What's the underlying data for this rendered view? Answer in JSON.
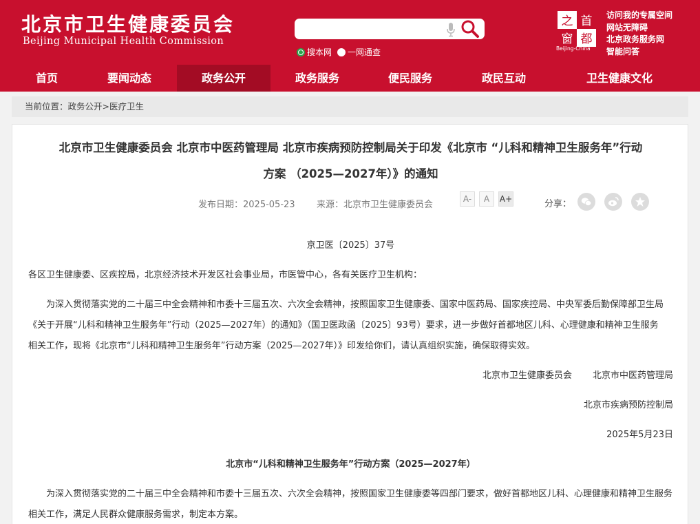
{
  "header": {
    "title": "北京市卫生健康委员会",
    "subtitle": "Beijing Municipal Health Commission",
    "search": {
      "placeholder": ""
    },
    "search_scopes": [
      {
        "label": "搜本网",
        "checked": true
      },
      {
        "label": "一网通查",
        "checked": false
      }
    ],
    "logo": {
      "chars": [
        "首",
        "都",
        "之",
        "窗"
      ],
      "caption": "Beijing-China"
    },
    "quick_links": [
      "访问我的专属空间",
      "网站无障碍",
      "北京政务服务网",
      "智能问答"
    ]
  },
  "nav": {
    "items": [
      {
        "label": "首页",
        "active": false
      },
      {
        "label": "要闻动态",
        "active": false
      },
      {
        "label": "政务公开",
        "active": true
      },
      {
        "label": "政务服务",
        "active": false
      },
      {
        "label": "便民服务",
        "active": false
      },
      {
        "label": "政民互动",
        "active": false
      },
      {
        "label": "卫生健康文化",
        "active": false
      }
    ]
  },
  "breadcrumb": {
    "prefix": "当前位置：",
    "items": [
      "政务公开",
      "医疗卫生"
    ],
    "separator": ">"
  },
  "article": {
    "title_line1": "北京市卫生健康委员会 北京市中医药管理局 北京市疾病预防控制局关于印发《北京市 “儿科和精神卫生服务年”行动",
    "title_line2": "方案 （2025—2027年）》的通知",
    "date_label": "发布日期：",
    "date": "2025-05-23",
    "source_label": "来源：",
    "source": "北京市卫生健康委员会",
    "font_buttons": [
      "A-",
      "A",
      "A+"
    ],
    "share_label": "分享：",
    "share_icons": [
      "wechat-icon",
      "weibo-icon",
      "favorite-icon"
    ],
    "doc_number": "京卫医〔2025〕37号",
    "salutation": "各区卫生健康委、区疾控局，北京经济技术开发区社会事业局，市医管中心，各有关医疗卫生机构：",
    "body_lines": [
      "为深入贯彻落实党的二十届三中全会精神和市委十三届五次、六次全会精神，按照国家卫生健康委、国家中医药局、国家疾控局、中央军委后勤保障部卫生局",
      "《关于开展“儿科和精神卫生服务年”行动（2025—2027年）的通知》（国卫医政函〔2025〕93号）要求，进一步做好首都地区儿科、心理健康和精神卫生服务",
      "相关工作，现将《北京市“儿科和精神卫生服务年”行动方案（2025—2027年）》印发给你们，请认真组织实施，确保取得实效。"
    ],
    "signatories_line1_a": "北京市卫生健康委员会",
    "signatories_line1_b": "北京市中医药管理局",
    "signatories_line2": "北京市疾病预防控制局",
    "sign_date": "2025年5月23日",
    "plan_title": "北京市“儿科和精神卫生服务年”行动方案（2025—2027年）",
    "plan_lines": [
      "为深入贯彻落实党的二十届三中全会精神和市委十三届五次、六次全会精神，按照国家卫生健康委等四部门要求，做好首都地区儿科、心理健康和精神卫生服务",
      "相关工作，满足人民群众健康服务需求，制定本方案。"
    ]
  },
  "colors": {
    "brand_red": "#c8102e",
    "nav_active": "#a30c24",
    "radio_green": "#2aa34b"
  }
}
